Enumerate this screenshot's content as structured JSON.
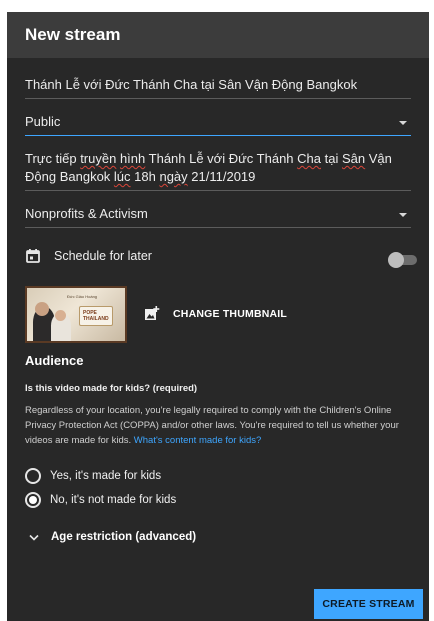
{
  "dialog": {
    "title": "New stream"
  },
  "form": {
    "title_value": "Thánh Lễ với Đức Thánh Cha tại Sân Vận Động Bangkok",
    "visibility": "Public",
    "description_parts": [
      "Trực tiếp ",
      "truyền",
      " ",
      "hình",
      " Thánh Lễ với Đức Thánh ",
      "Cha",
      " tại ",
      "Sân",
      " Vận Động ",
      "Bangkok",
      " ",
      "lúc",
      " 18h ",
      "ngày",
      " 21/11/2019"
    ],
    "category": "Nonprofits & Activism",
    "schedule_label": "Schedule for later",
    "schedule_enabled": false
  },
  "thumbnail": {
    "caption_top": "Đức Giáo Hoàng",
    "logo_line1": "POPE",
    "logo_line2": "THAILAND",
    "change_label": "CHANGE THUMBNAIL"
  },
  "audience": {
    "title": "Audience",
    "question": "Is this video made for kids? (required)",
    "help_text": "Regardless of your location, you're legally required to comply with the Children's Online Privacy Protection Act (COPPA) and/or other laws. You're required to tell us whether your videos are made for kids. ",
    "help_link": "What's content made for kids?",
    "options": [
      {
        "label": "Yes, it's made for kids",
        "checked": false
      },
      {
        "label": "No, it's not made for kids",
        "checked": true
      }
    ],
    "age_restriction_label": "Age restriction (advanced)"
  },
  "actions": {
    "create_label": "CREATE STREAM"
  },
  "colors": {
    "accent": "#3ea6ff",
    "background": "#282828",
    "header": "#3c3c3c"
  },
  "icons": {
    "schedule": "calendar-icon",
    "thumbnail": "add-photo-icon",
    "visibility_dropdown": "caret-down-icon",
    "category_dropdown": "caret-down-icon",
    "age_expand": "chevron-down-icon"
  }
}
